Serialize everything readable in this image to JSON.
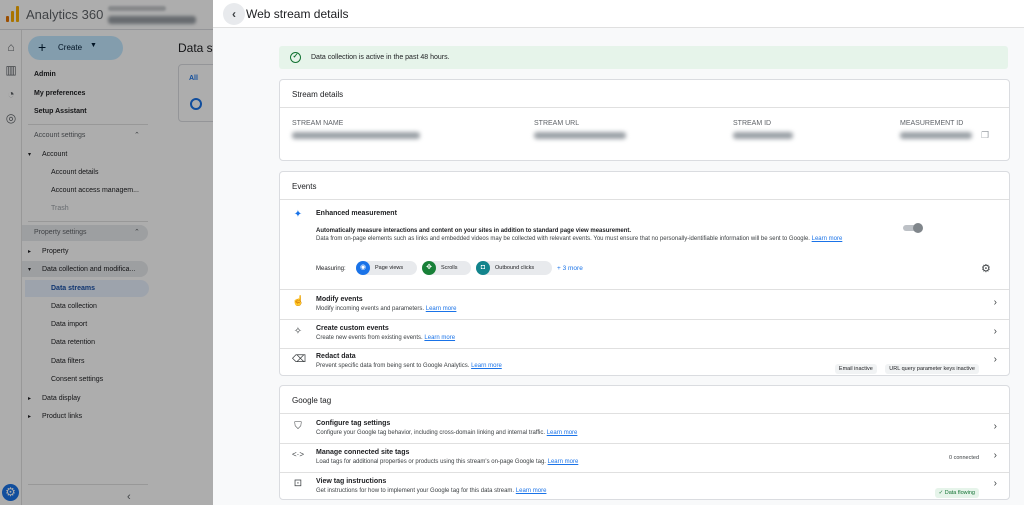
{
  "app": {
    "title": "Analytics 360"
  },
  "nav": {
    "create_label": "Create",
    "items": [
      {
        "label": "Admin"
      },
      {
        "label": "My preferences"
      },
      {
        "label": "Setup Assistant"
      },
      {
        "label": "Account settings"
      },
      {
        "label": "Account"
      },
      {
        "label": "Account details"
      },
      {
        "label": "Account access managem..."
      },
      {
        "label": "Trash"
      },
      {
        "label": "Property settings"
      },
      {
        "label": "Property"
      },
      {
        "label": "Data collection and modifica..."
      },
      {
        "label": "Data streams"
      },
      {
        "label": "Data collection"
      },
      {
        "label": "Data import"
      },
      {
        "label": "Data retention"
      },
      {
        "label": "Data filters"
      },
      {
        "label": "Consent settings"
      },
      {
        "label": "Data display"
      },
      {
        "label": "Product links"
      }
    ]
  },
  "background": {
    "title": "Data st",
    "tab_all": "All"
  },
  "panel": {
    "title": "Web stream details",
    "alert": "Data collection is active in the past 48 hours.",
    "stream_details": {
      "heading": "Stream details",
      "columns": [
        "STREAM NAME",
        "STREAM URL",
        "STREAM ID",
        "MEASUREMENT ID"
      ]
    },
    "events": {
      "heading": "Events",
      "enhanced": {
        "title": "Enhanced measurement",
        "desc1": "Automatically measure interactions and content on your sites in addition to standard page view measurement.",
        "desc2": "Data from on-page elements such as links and embedded videos may be collected with relevant events. You must ensure that no personally-identifiable information will be sent to Google.",
        "learn": "Learn more",
        "enabled": true,
        "measuring_label": "Measuring:",
        "chips": [
          "Page views",
          "Scrolls",
          "Outbound clicks"
        ],
        "more": "+ 3 more"
      },
      "rows": [
        {
          "title": "Modify events",
          "desc": "Modify incoming events and parameters.",
          "learn": "Learn more"
        },
        {
          "title": "Create custom events",
          "desc": "Create new events from existing events.",
          "learn": "Learn more"
        },
        {
          "title": "Redact data",
          "desc": "Prevent specific data from being sent to Google Analytics.",
          "learn": "Learn more",
          "chips": [
            "Email inactive",
            "URL query parameter keys inactive"
          ]
        }
      ]
    },
    "google_tag": {
      "heading": "Google tag",
      "rows": [
        {
          "title": "Configure tag settings",
          "desc": "Configure your Google tag behavior, including cross-domain linking and internal traffic.",
          "learn": "Learn more"
        },
        {
          "title": "Manage connected site tags",
          "desc": "Load tags for additional properties or products using this stream's on-page Google tag.",
          "learn": "Learn more",
          "status": "0 connected"
        },
        {
          "title": "View tag instructions",
          "desc": "Get instructions for how to implement your Google tag for this data stream.",
          "learn": "Learn more",
          "status": "Data flowing"
        }
      ]
    }
  },
  "colors": {
    "accent": "#1a73e8",
    "success": "#137333",
    "success_bg": "#e6f4ea"
  },
  "icons": {
    "measure_chips": [
      "eye-icon",
      "scroll-icon",
      "outbound-click-icon"
    ]
  }
}
